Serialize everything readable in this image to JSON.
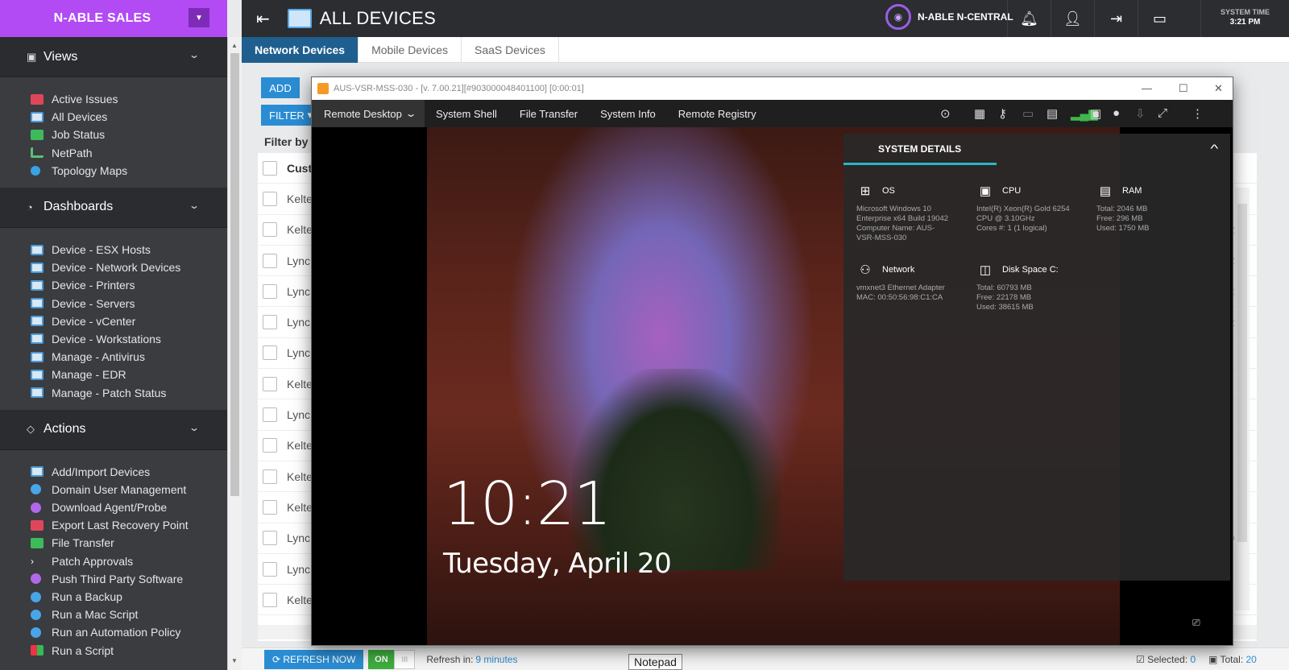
{
  "sidebar": {
    "brand": "N-ABLE SALES",
    "views": {
      "title": "Views",
      "items": [
        {
          "label": "Active Issues",
          "icon": "alert-icon"
        },
        {
          "label": "All Devices",
          "icon": "monitor-icon"
        },
        {
          "label": "Job Status",
          "icon": "check-icon"
        },
        {
          "label": "NetPath",
          "icon": "netpath-icon"
        },
        {
          "label": "Topology Maps",
          "icon": "topology-icon"
        }
      ]
    },
    "dashboards": {
      "title": "Dashboards",
      "items": [
        {
          "label": "Device - ESX Hosts"
        },
        {
          "label": "Device - Network Devices"
        },
        {
          "label": "Device - Printers"
        },
        {
          "label": "Device - Servers"
        },
        {
          "label": "Device - vCenter"
        },
        {
          "label": "Device - Workstations"
        },
        {
          "label": "Manage - Antivirus"
        },
        {
          "label": "Manage - EDR"
        },
        {
          "label": "Manage - Patch Status"
        }
      ]
    },
    "actions": {
      "title": "Actions",
      "items": [
        {
          "label": "Add/Import Devices"
        },
        {
          "label": "Domain User Management"
        },
        {
          "label": "Download Agent/Probe"
        },
        {
          "label": "Export Last Recovery Point"
        },
        {
          "label": "File Transfer"
        },
        {
          "label": "Patch Approvals"
        },
        {
          "label": "Push Third Party Software"
        },
        {
          "label": "Run a Backup"
        },
        {
          "label": "Run a Mac Script"
        },
        {
          "label": "Run an Automation Policy"
        },
        {
          "label": "Run a Script"
        }
      ]
    }
  },
  "topbar": {
    "title": "ALL DEVICES",
    "product": "N-ABLE N-CENTRAL",
    "system_time_label": "SYSTEM TIME",
    "system_time": "3:21 PM"
  },
  "tabs": [
    "Network Devices",
    "Mobile Devices",
    "SaaS Devices"
  ],
  "list": {
    "add_label": "ADD",
    "filter_label": "FILTER",
    "filter_by": "Filter by",
    "column_header": "Cust",
    "rows": [
      {
        "name": "Kelte",
        "right": ""
      },
      {
        "name": "Kelte",
        "right": "25"
      },
      {
        "name": "Lync",
        "right": "25"
      },
      {
        "name": "Lync",
        "right": "25"
      },
      {
        "name": "Lync",
        "right": "25"
      },
      {
        "name": "Lync",
        "right": ""
      },
      {
        "name": "Kelte",
        "right": ""
      },
      {
        "name": "Lync",
        "right": ""
      },
      {
        "name": "Kelte",
        "right": ""
      },
      {
        "name": "Kelte",
        "right": ""
      },
      {
        "name": "Kelte",
        "right": ""
      },
      {
        "name": "Lync",
        "right": "91"
      },
      {
        "name": "Lync",
        "right": ""
      },
      {
        "name": "Kelte",
        "right": ""
      }
    ]
  },
  "bottom": {
    "refresh_label": "REFRESH NOW",
    "toggle_on": "ON",
    "refresh_in_label": "Refresh in:",
    "refresh_in_value": "9 minutes",
    "selected_label": "Selected:",
    "selected_value": "0",
    "total_label": "Total:",
    "total_value": "20",
    "tooltip": "Notepad"
  },
  "remote": {
    "title": "AUS-VSR-MSS-030 -",
    "version": "[v. 7.00.21][#903000048401100] [0:00:01]",
    "menu": [
      "Remote Desktop",
      "System Shell",
      "File Transfer",
      "System Info",
      "Remote Registry"
    ],
    "clock": "10:21",
    "date": "Tuesday, April 20",
    "system_details": {
      "title": "SYSTEM DETAILS",
      "os": {
        "title": "OS",
        "value": "Microsoft Windows 10\nEnterprise x64 Build 19042\nComputer Name: AUS-\nVSR-MSS-030"
      },
      "cpu": {
        "title": "CPU",
        "value": "Intel(R) Xeon(R) Gold 6254\nCPU @ 3.10GHz\nCores #: 1 (1 logical)"
      },
      "ram": {
        "title": "RAM",
        "value": "Total: 2046 MB\nFree: 296 MB\nUsed: 1750 MB"
      },
      "network": {
        "title": "Network",
        "value": "vmxnet3 Ethernet Adapter\nMAC: 00:50:56:98:C1:CA"
      },
      "disk": {
        "title": "Disk Space C:",
        "value": "Total: 60793 MB\nFree: 22178 MB\nUsed: 38615 MB"
      }
    }
  }
}
